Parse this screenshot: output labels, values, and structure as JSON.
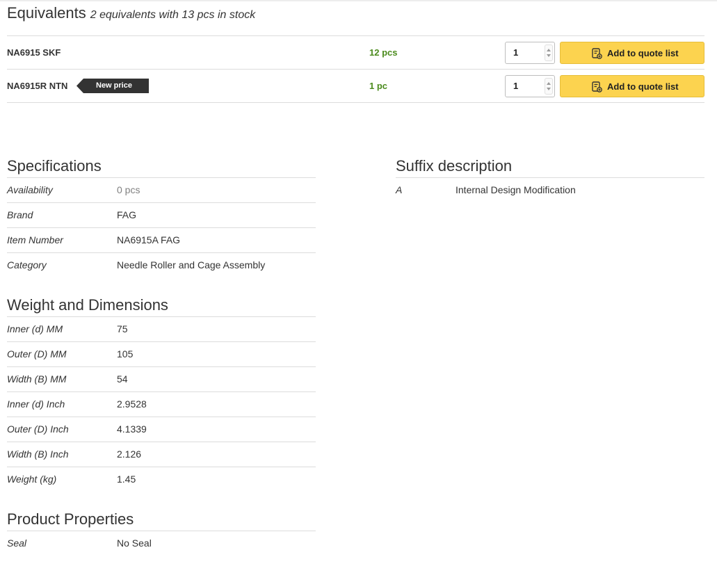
{
  "equivalents": {
    "title": "Equivalents",
    "subtitle": "2 equivalents with 13 pcs in stock",
    "rows": [
      {
        "name": "NA6915 SKF",
        "tag": "",
        "stock": "12 pcs",
        "quantity": "1",
        "button_label": "Add to quote list"
      },
      {
        "name": "NA6915R NTN",
        "tag": "New price",
        "stock": "1 pc",
        "quantity": "1",
        "button_label": "Add to quote list"
      }
    ]
  },
  "specifications": {
    "title": "Specifications",
    "rows": [
      {
        "label": "Availability",
        "value": "0 pcs"
      },
      {
        "label": "Brand",
        "value": "FAG"
      },
      {
        "label": "Item Number",
        "value": "NA6915A FAG"
      },
      {
        "label": "Category",
        "value": "Needle Roller and Cage Assembly"
      }
    ]
  },
  "weight_dimensions": {
    "title": "Weight and Dimensions",
    "rows": [
      {
        "label": "Inner (d) MM",
        "value": "75"
      },
      {
        "label": "Outer (D) MM",
        "value": "105"
      },
      {
        "label": "Width (B) MM",
        "value": "54"
      },
      {
        "label": "Inner (d) Inch",
        "value": "2.9528"
      },
      {
        "label": "Outer (D) Inch",
        "value": "4.1339"
      },
      {
        "label": "Width (B) Inch",
        "value": "2.126"
      },
      {
        "label": "Weight (kg)",
        "value": "1.45"
      }
    ]
  },
  "product_properties": {
    "title": "Product Properties",
    "rows": [
      {
        "label": "Seal",
        "value": "No Seal"
      }
    ]
  },
  "suffix_description": {
    "title": "Suffix description",
    "rows": [
      {
        "label": "A",
        "value": "Internal Design Modification"
      }
    ]
  },
  "colors": {
    "in_stock_green": "#4b8b1d",
    "button_yellow": "#fcd34f",
    "tag_dark": "#333333"
  },
  "icons": {
    "quote_button": "quote-list-icon",
    "qty_spinner": "stepper-arrows-icon"
  }
}
